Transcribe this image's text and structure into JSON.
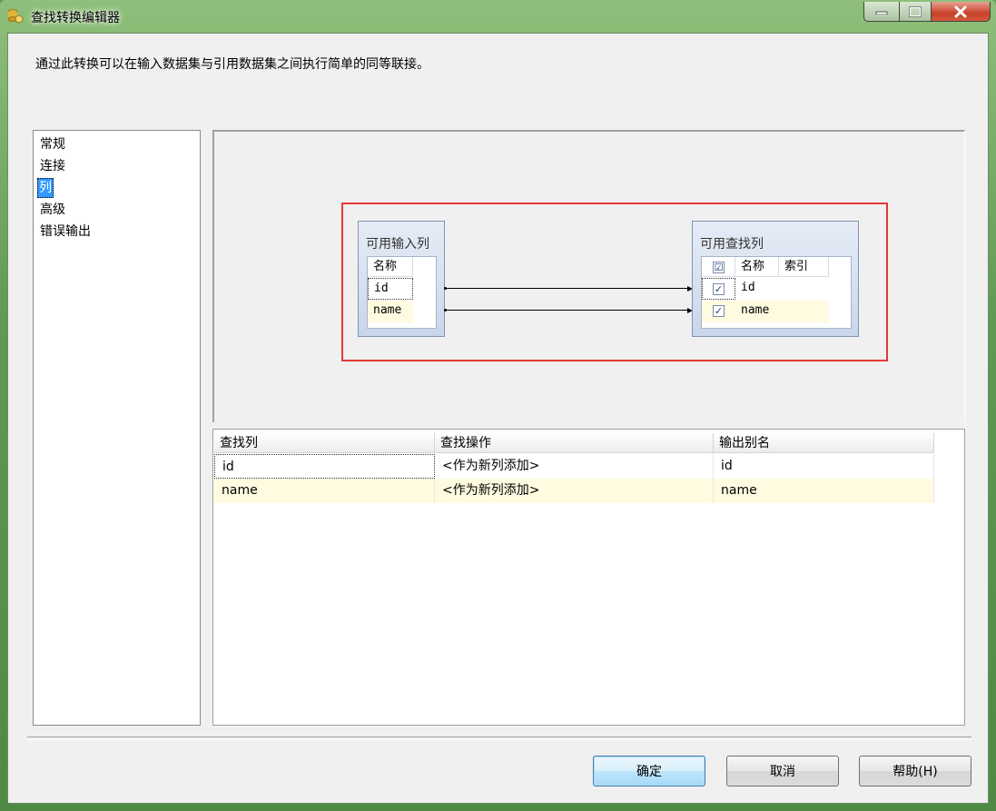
{
  "window": {
    "title": "查找转换编辑器"
  },
  "description": "通过此转换可以在输入数据集与引用数据集之间执行简单的同等联接。",
  "nav": {
    "items": [
      {
        "label": "常规",
        "selected": false
      },
      {
        "label": "连接",
        "selected": false
      },
      {
        "label": "列",
        "selected": true
      },
      {
        "label": "高级",
        "selected": false
      },
      {
        "label": "错误输出",
        "selected": false
      }
    ]
  },
  "mapping": {
    "input_box": {
      "title": "可用输入列",
      "header": "名称",
      "rows": [
        "id",
        "name"
      ]
    },
    "lookup_box": {
      "title": "可用查找列",
      "headers": {
        "check": "☑",
        "name": "名称",
        "index": "索引"
      },
      "rows": [
        {
          "checked": true,
          "name": "id",
          "index": ""
        },
        {
          "checked": true,
          "name": "name",
          "index": ""
        }
      ]
    }
  },
  "grid": {
    "headers": [
      "查找列",
      "查找操作",
      "输出别名"
    ],
    "rows": [
      [
        "id",
        "<作为新列添加>",
        "id"
      ],
      [
        "name",
        "<作为新列添加>",
        "name"
      ]
    ]
  },
  "buttons": {
    "ok": "确定",
    "cancel": "取消",
    "help": "帮助(H)"
  },
  "colors": {
    "selection": "#3399ff",
    "highlight_border": "#e53935",
    "row_highlight": "#fffbe0"
  }
}
